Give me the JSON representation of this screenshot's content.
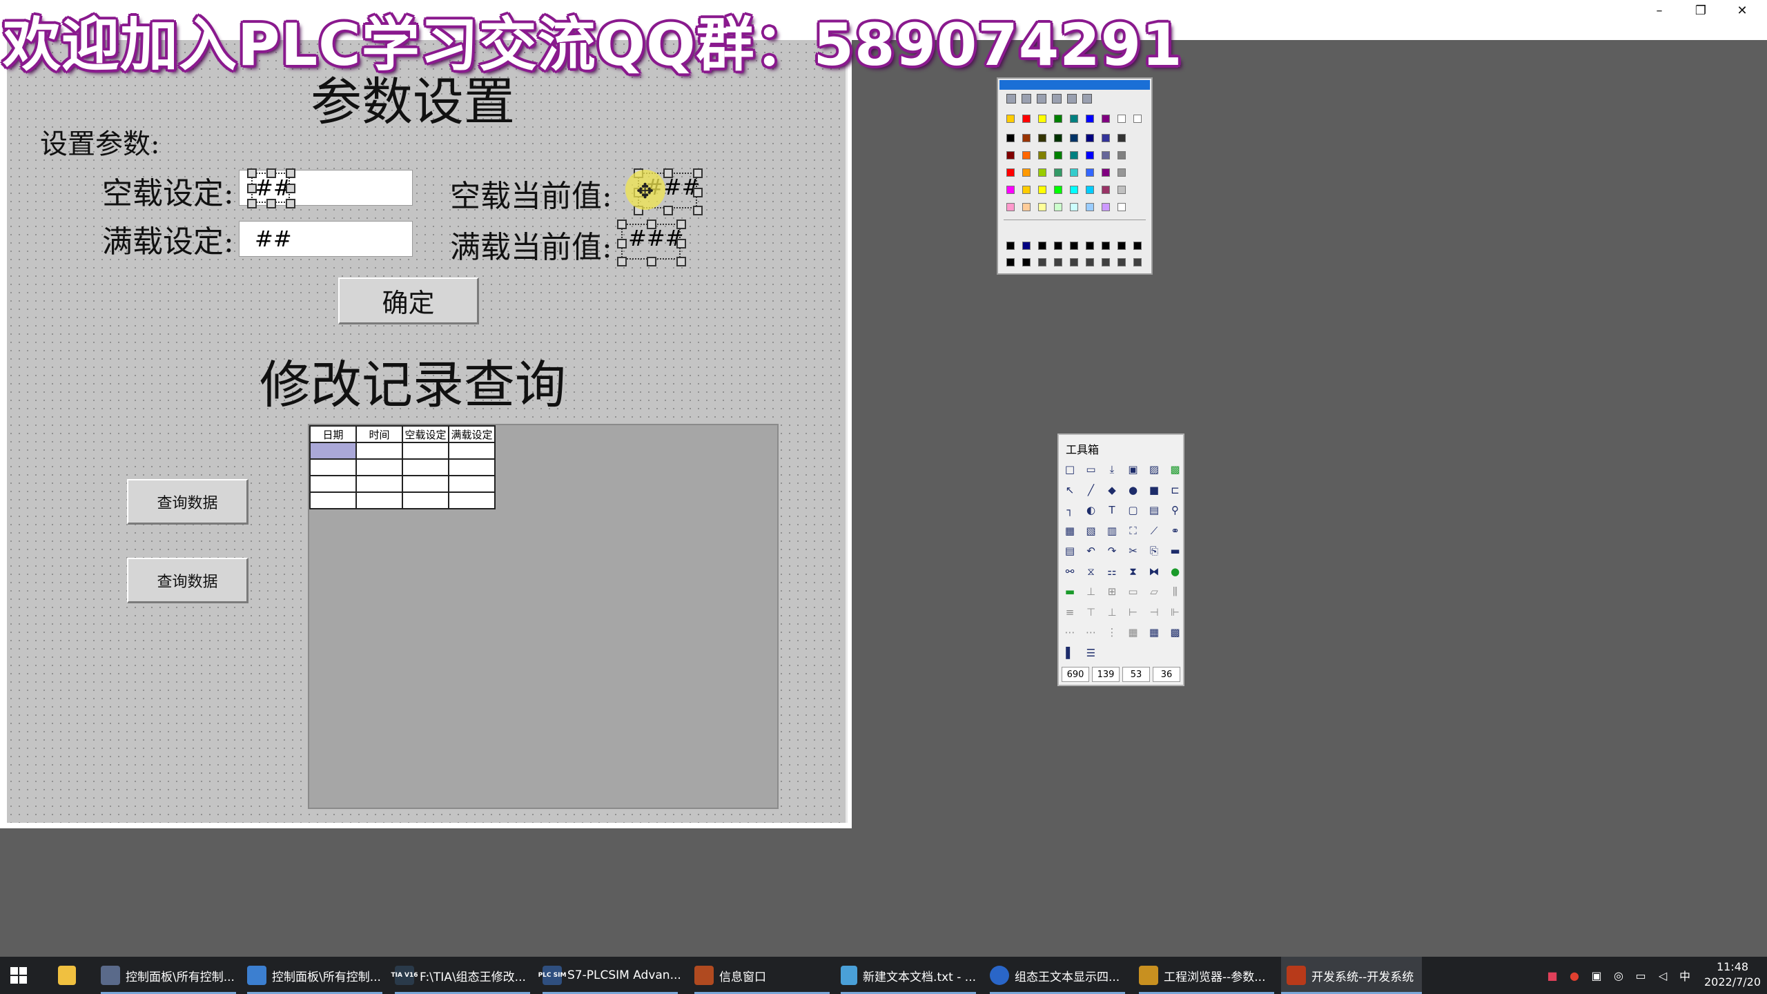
{
  "banner": {
    "text": "欢迎加入PLC学习交流QQ群：589074291"
  },
  "window": {
    "minimize": "–",
    "restore": "❐",
    "close": "✕"
  },
  "screen": {
    "title": "参数设置",
    "subtitle": "设置参数:",
    "empty_label": "空载设定:",
    "empty_input": "##",
    "full_label": "满载设定:",
    "full_input": "##",
    "empty_current_label": "空载当前值:",
    "empty_current_value": "###",
    "full_current_label": "满载当前值:",
    "full_current_value": "###",
    "confirm_button": "确定",
    "query_title": "修改记录查询",
    "query_button_1": "查询数据",
    "query_button_2": "查询数据",
    "table": {
      "columns": [
        "日期",
        "时间",
        "空载设定",
        "满载设定"
      ],
      "rows": [
        [
          "",
          "",
          "",
          ""
        ],
        [
          "",
          "",
          "",
          ""
        ],
        [
          "",
          "",
          "",
          ""
        ],
        [
          "",
          "",
          "",
          ""
        ]
      ]
    }
  },
  "toolbox": {
    "title": "工具箱",
    "coords": [
      "690",
      "139",
      "53",
      "36"
    ],
    "tools": [
      "new-icon",
      "open-icon",
      "import-icon",
      "save-icon",
      "image-icon",
      "green-image-icon",
      "pointer-icon",
      "line-icon",
      "ellipse-icon",
      "circle-icon",
      "rect-icon",
      "polyline-icon",
      "pipe-icon",
      "pie-icon",
      "text-icon",
      "rounded-rect-icon",
      "button-icon",
      "gauge-icon",
      "symbol-icon",
      "report-icon",
      "control-icon",
      "chart-icon",
      "trend-icon",
      "link-icon",
      "bitmap-icon",
      "undo-icon",
      "redo-icon",
      "cut-icon",
      "copy-icon",
      "paste-icon",
      "group-icon",
      "ungroup-icon",
      "merge-icon",
      "align-icon",
      "split-icon",
      "dot-icon",
      "front-icon",
      "back-icon",
      "layer-icon",
      "duplicate-icon",
      "copy-style-icon",
      "spacing-icon",
      "align-top-icon",
      "align-vcenter-icon",
      "align-bottom-icon",
      "align-left-icon",
      "align-hcenter-icon",
      "align-right-icon",
      "hspace-icon",
      "hdots-icon",
      "vdots-icon",
      "grid-icon",
      "palette-icon",
      "color-grid-icon",
      "fill-icon",
      "line-style-icon"
    ]
  },
  "palette": {
    "rows": [
      [
        "#000000",
        "#993300",
        "#333300",
        "#003300",
        "#003366",
        "#000080",
        "#333399",
        "#333333"
      ],
      [
        "#800000",
        "#ff6600",
        "#808000",
        "#008000",
        "#008080",
        "#0000ff",
        "#666699",
        "#808080"
      ],
      [
        "#ff0000",
        "#ff9900",
        "#99cc00",
        "#339966",
        "#33cccc",
        "#3366ff",
        "#800080",
        "#969696"
      ],
      [
        "#ff00ff",
        "#ffcc00",
        "#ffff00",
        "#00ff00",
        "#00ffff",
        "#00ccff",
        "#993366",
        "#c0c0c0"
      ],
      [
        "#ff99cc",
        "#ffcc99",
        "#ffff99",
        "#ccffcc",
        "#ccffff",
        "#99ccff",
        "#cc99ff",
        "#ffffff"
      ]
    ],
    "accent": "#1a6fd6"
  },
  "taskbar": {
    "items": [
      "控制面板\\所有控制...",
      "控制面板\\所有控制...",
      "F:\\TIA\\组态王修改...",
      "S7-PLCSIM Advan...",
      "信息窗口",
      "新建文本文档.txt - ...",
      "组态王文本显示四...",
      "工程浏览器--参数...",
      "开发系统--开发系统"
    ],
    "tia_badge": "TIA V16",
    "plc_badge": "PLC SIM",
    "ime": "中",
    "time": "11:48",
    "date": "2022/7/20"
  }
}
